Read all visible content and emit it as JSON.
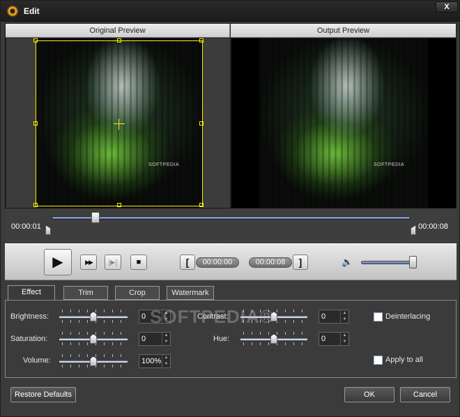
{
  "window": {
    "title": "Edit",
    "close_label": "X"
  },
  "preview": {
    "original_header": "Original Preview",
    "output_header": "Output Preview",
    "watermark": "SOFTPEDIA"
  },
  "timeline": {
    "start_time": "00:00:01",
    "end_time": "00:00:08",
    "position_fraction": 0.12
  },
  "playback": {
    "play_icon": "▶",
    "next_frame_icon": "▶▶",
    "snapshot_icon": "[▶]",
    "stop_icon": "■",
    "start_bracket": "[",
    "end_bracket": "]",
    "start_time": "00:00:00",
    "end_time": "00:00:08",
    "volume_icon": "🔈",
    "volume_level": 1.0
  },
  "tabs": [
    {
      "label": "Effect",
      "active": true
    },
    {
      "label": "Trim",
      "active": false
    },
    {
      "label": "Crop",
      "active": false
    },
    {
      "label": "Watermark",
      "active": false
    }
  ],
  "effect": {
    "brightness": {
      "label": "Brightness:",
      "value": "0"
    },
    "saturation": {
      "label": "Saturation:",
      "value": "0"
    },
    "volume": {
      "label": "Volume:",
      "value": "100%"
    },
    "contrast": {
      "label": "Contrast:",
      "value": "0"
    },
    "hue": {
      "label": "Hue:",
      "value": "0"
    },
    "deinterlacing": {
      "label": "Deinterlacing",
      "checked": false
    },
    "apply_to_all": {
      "label": "Apply to all",
      "checked": false
    },
    "watermark_overlay": "SOFTPEDIA®"
  },
  "buttons": {
    "restore": "Restore Defaults",
    "ok": "OK",
    "cancel": "Cancel"
  }
}
